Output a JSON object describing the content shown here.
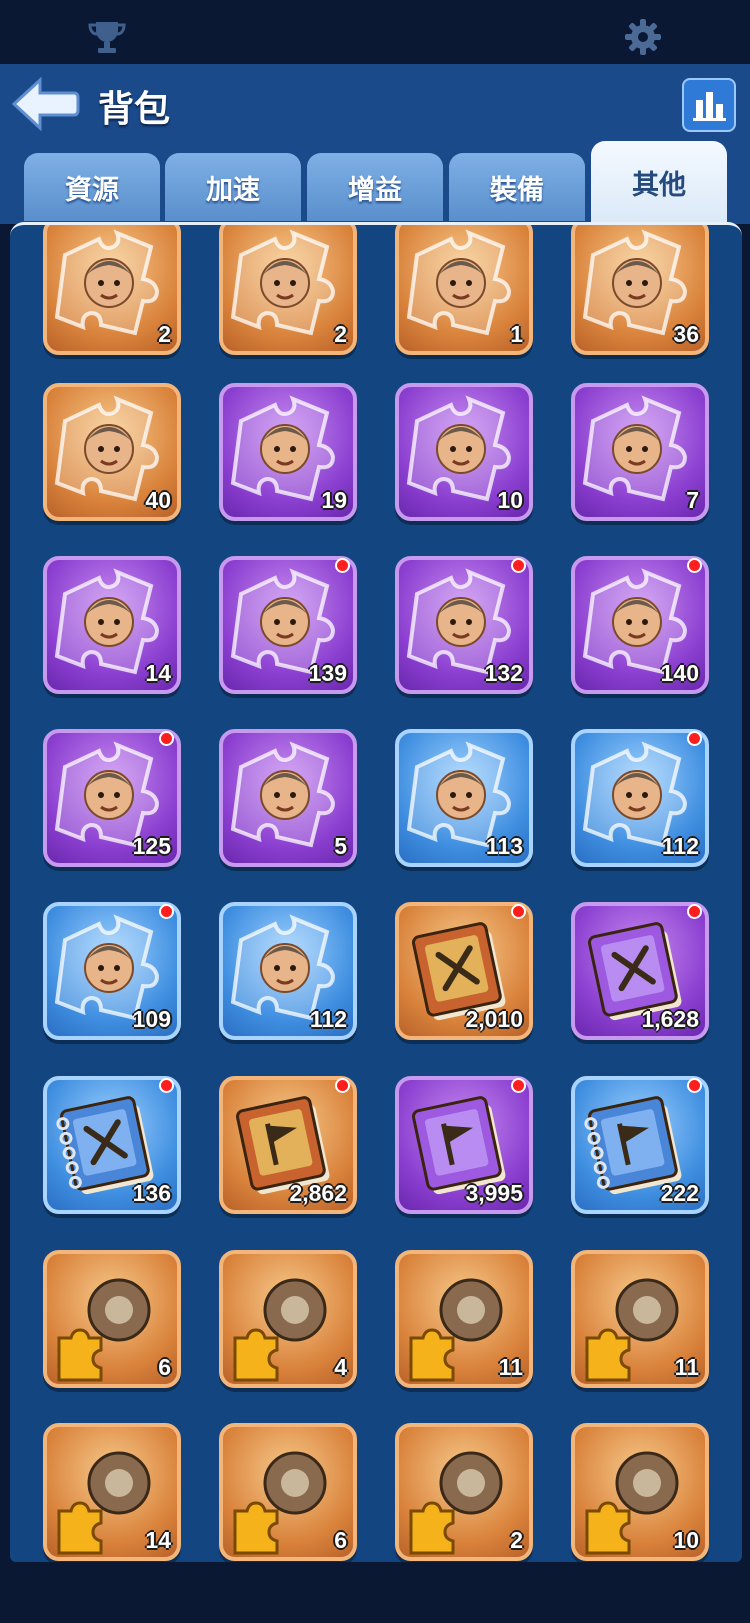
{
  "header": {
    "title": "背包",
    "icons": {
      "trophy": "trophy-icon",
      "settings": "gear-icon",
      "back": "back-arrow-icon",
      "stats": "bar-chart-icon"
    }
  },
  "tabs": [
    {
      "label": "資源",
      "active": false
    },
    {
      "label": "加速",
      "active": false
    },
    {
      "label": "增益",
      "active": false
    },
    {
      "label": "裝備",
      "active": false
    },
    {
      "label": "其他",
      "active": true
    }
  ],
  "items": [
    {
      "count": "2",
      "rarity": "orange",
      "type": "hero-puzzle",
      "dot": false
    },
    {
      "count": "2",
      "rarity": "orange",
      "type": "hero-puzzle",
      "dot": false
    },
    {
      "count": "1",
      "rarity": "orange",
      "type": "hero-puzzle",
      "dot": false
    },
    {
      "count": "36",
      "rarity": "orange",
      "type": "hero-puzzle",
      "dot": false
    },
    {
      "count": "40",
      "rarity": "orange",
      "type": "hero-puzzle",
      "dot": false
    },
    {
      "count": "19",
      "rarity": "purple",
      "type": "hero-puzzle",
      "dot": false
    },
    {
      "count": "10",
      "rarity": "purple",
      "type": "hero-puzzle",
      "dot": false
    },
    {
      "count": "7",
      "rarity": "purple",
      "type": "hero-puzzle",
      "dot": false
    },
    {
      "count": "14",
      "rarity": "purple",
      "type": "hero-puzzle",
      "dot": false
    },
    {
      "count": "139",
      "rarity": "purple",
      "type": "hero-puzzle",
      "dot": true
    },
    {
      "count": "132",
      "rarity": "purple",
      "type": "hero-puzzle",
      "dot": true
    },
    {
      "count": "140",
      "rarity": "purple",
      "type": "hero-puzzle",
      "dot": true
    },
    {
      "count": "125",
      "rarity": "purple",
      "type": "hero-puzzle",
      "dot": true
    },
    {
      "count": "5",
      "rarity": "purple",
      "type": "hero-puzzle",
      "dot": false
    },
    {
      "count": "113",
      "rarity": "blue",
      "type": "hero-puzzle",
      "dot": false
    },
    {
      "count": "112",
      "rarity": "blue",
      "type": "hero-puzzle",
      "dot": true
    },
    {
      "count": "109",
      "rarity": "blue",
      "type": "hero-puzzle",
      "dot": true
    },
    {
      "count": "112",
      "rarity": "blue",
      "type": "hero-puzzle",
      "dot": false
    },
    {
      "count": "2,010",
      "rarity": "orange",
      "type": "book-swords",
      "dot": true
    },
    {
      "count": "1,628",
      "rarity": "purple",
      "type": "book-swords",
      "dot": true
    },
    {
      "count": "136",
      "rarity": "blue",
      "type": "book-swords-spiral",
      "dot": true
    },
    {
      "count": "2,862",
      "rarity": "orange",
      "type": "book-flag",
      "dot": true
    },
    {
      "count": "3,995",
      "rarity": "purple",
      "type": "book-flag",
      "dot": true
    },
    {
      "count": "222",
      "rarity": "blue",
      "type": "book-flag-spiral",
      "dot": true
    },
    {
      "count": "6",
      "rarity": "orange",
      "type": "gear-piece",
      "dot": false
    },
    {
      "count": "4",
      "rarity": "orange",
      "type": "gear-piece",
      "dot": false
    },
    {
      "count": "11",
      "rarity": "orange",
      "type": "gear-piece",
      "dot": false
    },
    {
      "count": "11",
      "rarity": "orange",
      "type": "gear-piece",
      "dot": false
    },
    {
      "count": "14",
      "rarity": "orange",
      "type": "gear-piece",
      "dot": false
    },
    {
      "count": "6",
      "rarity": "orange",
      "type": "gear-piece",
      "dot": false
    },
    {
      "count": "2",
      "rarity": "orange",
      "type": "gear-piece",
      "dot": false
    },
    {
      "count": "10",
      "rarity": "orange",
      "type": "gear-piece",
      "dot": false
    }
  ]
}
